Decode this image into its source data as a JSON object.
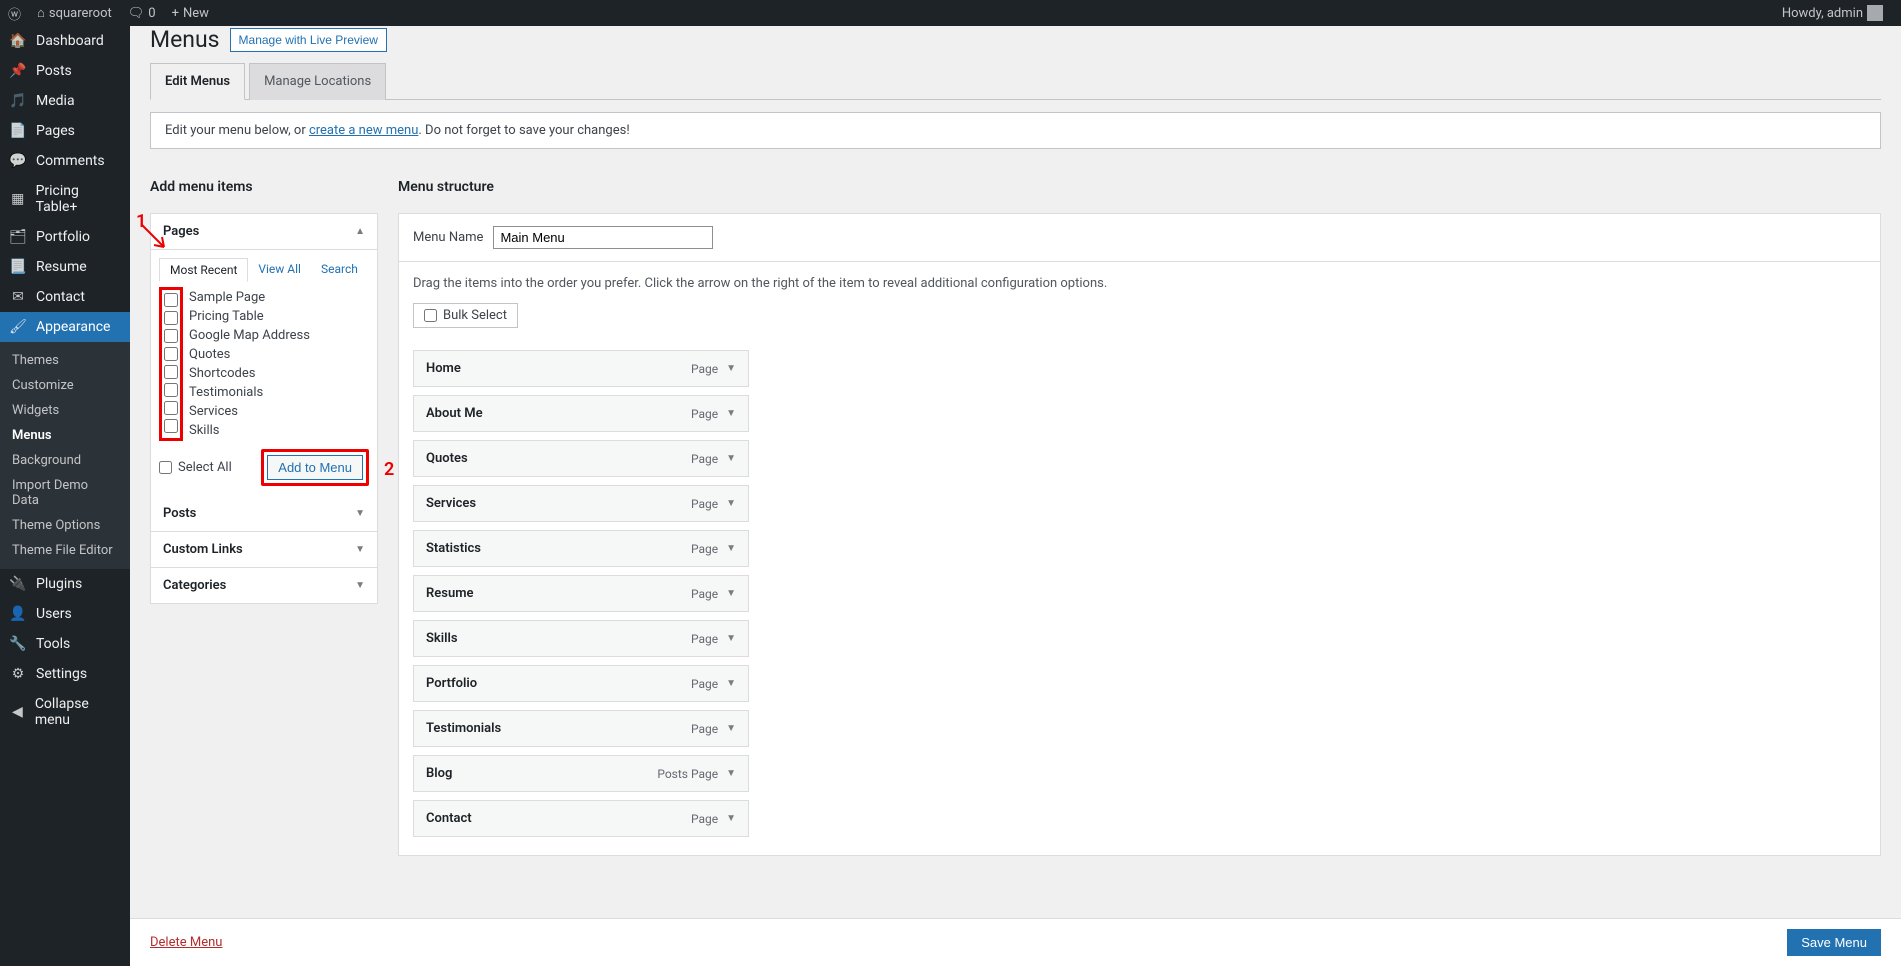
{
  "adminbar": {
    "site": "squareroot",
    "comments": "0",
    "new": "New",
    "howdy": "Howdy, admin"
  },
  "sidebar": {
    "items": [
      {
        "icon": "speedometer",
        "label": "Dashboard"
      },
      {
        "icon": "pin",
        "label": "Posts"
      },
      {
        "icon": "media",
        "label": "Media"
      },
      {
        "icon": "page",
        "label": "Pages"
      },
      {
        "icon": "comment",
        "label": "Comments"
      },
      {
        "icon": "table",
        "label": "Pricing Table+"
      },
      {
        "icon": "portfolio",
        "label": "Portfolio"
      },
      {
        "icon": "resume",
        "label": "Resume"
      },
      {
        "icon": "mail",
        "label": "Contact"
      },
      {
        "icon": "brush",
        "label": "Appearance",
        "active": true
      },
      {
        "icon": "plug",
        "label": "Plugins"
      },
      {
        "icon": "user",
        "label": "Users"
      },
      {
        "icon": "wrench",
        "label": "Tools"
      },
      {
        "icon": "sliders",
        "label": "Settings"
      },
      {
        "icon": "collapse",
        "label": "Collapse menu"
      }
    ],
    "appearance_sub": [
      "Themes",
      "Customize",
      "Widgets",
      "Menus",
      "Background",
      "Import Demo Data",
      "Theme Options",
      "Theme File Editor"
    ],
    "current_sub": "Menus"
  },
  "page": {
    "title": "Menus",
    "preview_button": "Manage with Live Preview",
    "tabs": [
      {
        "label": "Edit Menus",
        "active": true
      },
      {
        "label": "Manage Locations",
        "active": false
      }
    ],
    "notice_prefix": "Edit your menu below, or ",
    "notice_link": "create a new menu",
    "notice_suffix": ". Do not forget to save your changes!"
  },
  "add_menu": {
    "heading": "Add menu items",
    "pages_label": "Pages",
    "posts_label": "Posts",
    "custom_links_label": "Custom Links",
    "categories_label": "Categories",
    "inner_tabs": [
      {
        "label": "Most Recent",
        "active": true
      },
      {
        "label": "View All",
        "active": false
      },
      {
        "label": "Search",
        "active": false
      }
    ],
    "page_items": [
      "Sample Page",
      "Pricing Table",
      "Google Map Address",
      "Quotes",
      "Shortcodes",
      "Testimonials",
      "Services",
      "Skills"
    ],
    "select_all": "Select All",
    "add_to_menu": "Add to Menu"
  },
  "structure": {
    "heading": "Menu structure",
    "name_label": "Menu Name",
    "name_value": "Main Menu",
    "desc": "Drag the items into the order you prefer. Click the arrow on the right of the item to reveal additional configuration options.",
    "bulk": "Bulk Select",
    "items": [
      {
        "label": "Home",
        "type": "Page"
      },
      {
        "label": "About Me",
        "type": "Page"
      },
      {
        "label": "Quotes",
        "type": "Page"
      },
      {
        "label": "Services",
        "type": "Page"
      },
      {
        "label": "Statistics",
        "type": "Page"
      },
      {
        "label": "Resume",
        "type": "Page"
      },
      {
        "label": "Skills",
        "type": "Page"
      },
      {
        "label": "Portfolio",
        "type": "Page"
      },
      {
        "label": "Testimonials",
        "type": "Page"
      },
      {
        "label": "Blog",
        "type": "Posts Page"
      },
      {
        "label": "Contact",
        "type": "Page"
      }
    ]
  },
  "footer": {
    "delete": "Delete Menu",
    "save": "Save Menu"
  },
  "annotations": {
    "one": "1",
    "two": "2"
  }
}
